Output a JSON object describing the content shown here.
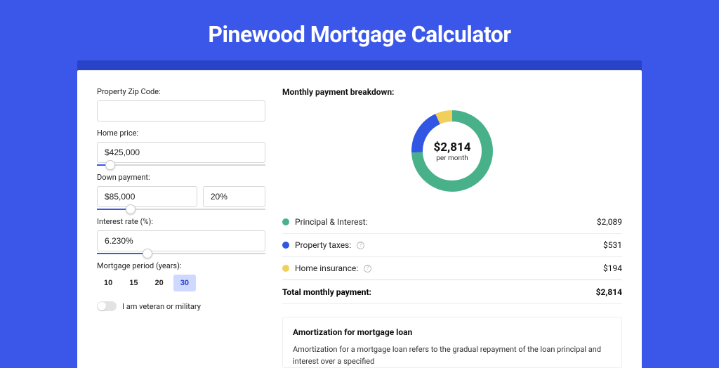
{
  "title": "Pinewood Mortgage Calculator",
  "form": {
    "zip": {
      "label": "Property Zip Code:",
      "value": ""
    },
    "home_price": {
      "label": "Home price:",
      "value": "$425,000",
      "slider_pct": 8
    },
    "down_payment": {
      "label": "Down payment:",
      "amount": "$85,000",
      "pct": "20%",
      "slider_pct": 20
    },
    "interest": {
      "label": "Interest rate (%):",
      "value": "6.230%",
      "slider_pct": 30
    },
    "period": {
      "label": "Mortgage period (years):",
      "options": [
        "10",
        "15",
        "20",
        "30"
      ],
      "active": "30"
    },
    "veteran": {
      "label": "I am veteran or military",
      "value": false
    }
  },
  "breakdown": {
    "title": "Monthly payment breakdown:",
    "center_amount": "$2,814",
    "center_sub": "per month",
    "items": [
      {
        "label": "Principal & Interest:",
        "value": "$2,089",
        "color": "#49b18a",
        "info": false,
        "num": 2089
      },
      {
        "label": "Property taxes:",
        "value": "$531",
        "color": "#3156e3",
        "info": true,
        "num": 531
      },
      {
        "label": "Home insurance:",
        "value": "$194",
        "color": "#f2cf5b",
        "info": true,
        "num": 194
      }
    ],
    "total_label": "Total monthly payment:",
    "total_value": "$2,814"
  },
  "amort": {
    "title": "Amortization for mortgage loan",
    "body": "Amortization for a mortgage loan refers to the gradual repayment of the loan principal and interest over a specified"
  },
  "chart_data": {
    "type": "pie",
    "title": "Monthly payment breakdown",
    "unit": "USD",
    "total": 2814,
    "series": [
      {
        "name": "Principal & Interest",
        "value": 2089,
        "color": "#49b18a"
      },
      {
        "name": "Property taxes",
        "value": 531,
        "color": "#3156e3"
      },
      {
        "name": "Home insurance",
        "value": 194,
        "color": "#f2cf5b"
      }
    ]
  }
}
